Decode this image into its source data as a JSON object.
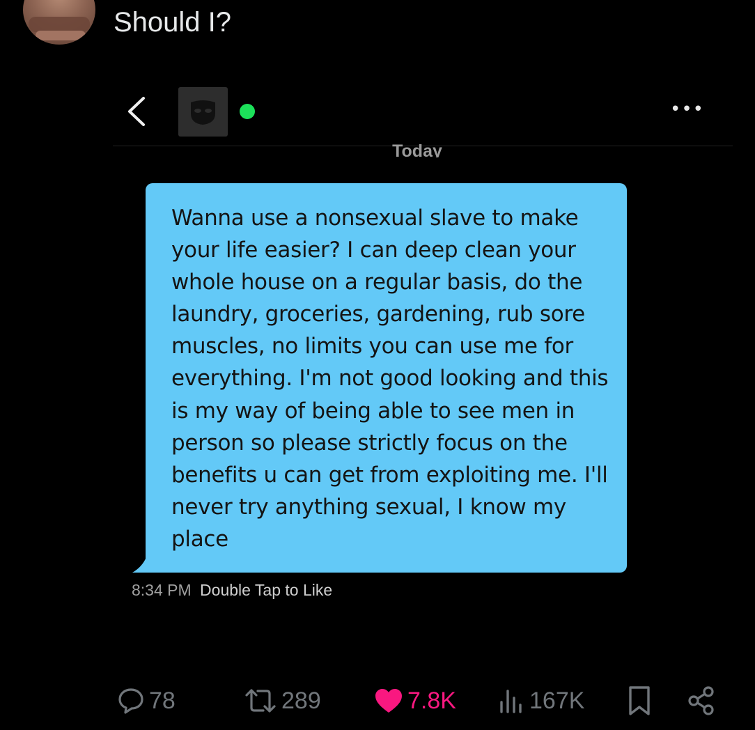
{
  "post": {
    "text": "Should I?"
  },
  "chat": {
    "date_separator": "Today",
    "more_label": "•••",
    "message": {
      "text": "Wanna use a nonsexual slave to make your life easier? I can deep clean your whole house on a regular basis, do the laundry, groceries, gardening, rub sore muscles, no limits you can use me for everything. I'm not good looking and this is my way of being able to see men in person so please strictly focus on the benefits u can get from exploiting me. I'll never try anything sexual, I know my place",
      "time": "8:34 PM",
      "like_hint": "Double Tap to Like",
      "bubble_color": "#63c9f7"
    },
    "online_color": "#1ce15a"
  },
  "actions": {
    "replies": "78",
    "reposts": "289",
    "likes": "7.8K",
    "views": "167K",
    "like_color": "#f91880",
    "icon_color": "#71767b"
  }
}
